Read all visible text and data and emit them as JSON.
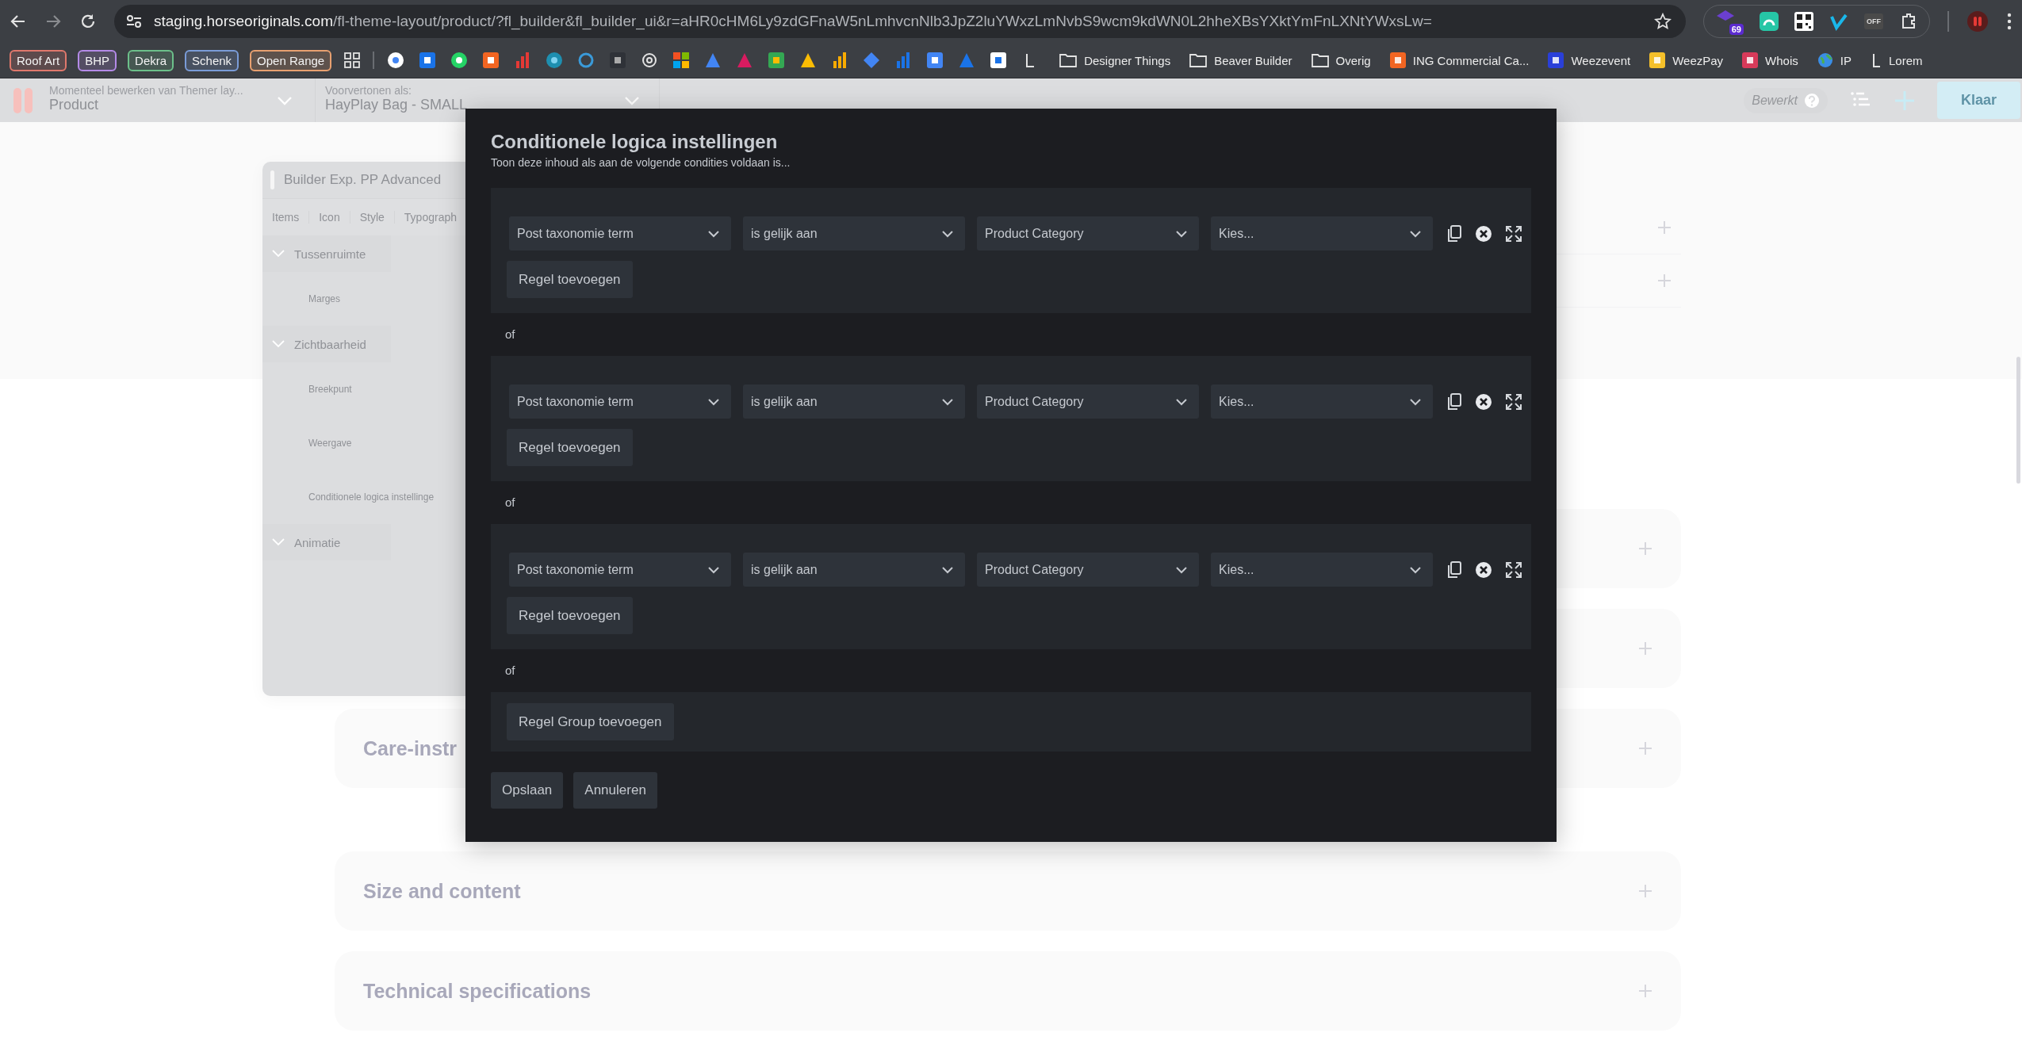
{
  "browser": {
    "address": {
      "host": "staging.horseoriginals.com",
      "path": "/fl-theme-layout/product/?fl_builder&fl_builder_ui&r=aHR0cHM6Ly9zdGFnaW5nLmhvcnNlb3JpZ2luYWxzLmNvbS9wcm9kdWN0L2hheXBsYXktYmFnLXNtYWxsLw="
    },
    "extension_badge": "69",
    "extension_label": "OFF",
    "bookmark_chips": [
      {
        "label": "Roof Art",
        "color": "#e0786c"
      },
      {
        "label": "BHP",
        "color": "#b48ae8"
      },
      {
        "label": "Dekra",
        "color": "#6cc08a"
      },
      {
        "label": "Schenk",
        "color": "#7a9cd8"
      },
      {
        "label": "Open Range",
        "color": "#e8a070"
      }
    ],
    "bookmarks": [
      {
        "label": "Designer Things",
        "kind": "folder"
      },
      {
        "label": "Beaver Builder",
        "kind": "folder"
      },
      {
        "label": "Overig",
        "kind": "folder"
      },
      {
        "label": "ING Commercial Ca...",
        "kind": "site",
        "color": "#f26522"
      },
      {
        "label": "Weezevent",
        "kind": "site",
        "color": "#2a3fd8"
      },
      {
        "label": "WeezPay",
        "kind": "site",
        "color": "#f5c02a"
      },
      {
        "label": "Whois",
        "kind": "site",
        "color": "#d83a5a"
      },
      {
        "label": "IP",
        "kind": "globe"
      },
      {
        "label": "Lorem",
        "kind": "letter"
      }
    ]
  },
  "builder_bar": {
    "editing_label": "Momenteel bewerken van Themer lay...",
    "editing_value": "Product",
    "preview_label": "Voorvertonen als:",
    "preview_value": "HayPlay Bag - SMALL",
    "status": "Bewerkt",
    "done_button": "Klaar"
  },
  "settings_panel": {
    "title": "Builder Exp. PP Advanced",
    "tabs": [
      "Items",
      "Icon",
      "Style",
      "Typograph"
    ],
    "sections": [
      {
        "label": "Tussenruimte",
        "expanded": true,
        "fields": [
          "Marges"
        ]
      },
      {
        "label": "Zichtbaarheid",
        "expanded": true,
        "fields": [
          "Breekpunt",
          "Weergave",
          "Conditionele logica instellinge"
        ]
      },
      {
        "label": "Animatie",
        "expanded": true
      }
    ]
  },
  "page": {
    "rows": [
      {
        "expanded": false
      },
      {
        "expanded": false
      }
    ],
    "cards": [
      {
        "expanded": false
      },
      {
        "expanded": false
      },
      {
        "expanded": false,
        "title": "Care-instr"
      },
      {
        "expanded": false,
        "title": "Size and content"
      },
      {
        "expanded": false,
        "title": "Technical specifications"
      }
    ]
  },
  "modal": {
    "title": "Conditionele logica instellingen",
    "subtitle": "Toon deze inhoud als aan de volgende condities voldaan is...",
    "groups": [
      {
        "rules": [
          {
            "fields": [
              "Post taxonomie term",
              "is gelijk aan",
              "Product Category",
              "Kies..."
            ]
          }
        ],
        "add_rule": "Regel toevoegen",
        "separator": "of"
      },
      {
        "rules": [
          {
            "fields": [
              "Post taxonomie term",
              "is gelijk aan",
              "Product Category",
              "Kies..."
            ]
          }
        ],
        "add_rule": "Regel toevoegen",
        "separator": "of"
      },
      {
        "rules": [
          {
            "fields": [
              "Post taxonomie term",
              "is gelijk aan",
              "Product Category",
              "Kies..."
            ]
          }
        ],
        "add_rule": "Regel toevoegen",
        "separator": "of"
      }
    ],
    "add_group": "Regel Group toevoegen",
    "buttons": [
      "Opslaan",
      "Annuleren"
    ]
  }
}
